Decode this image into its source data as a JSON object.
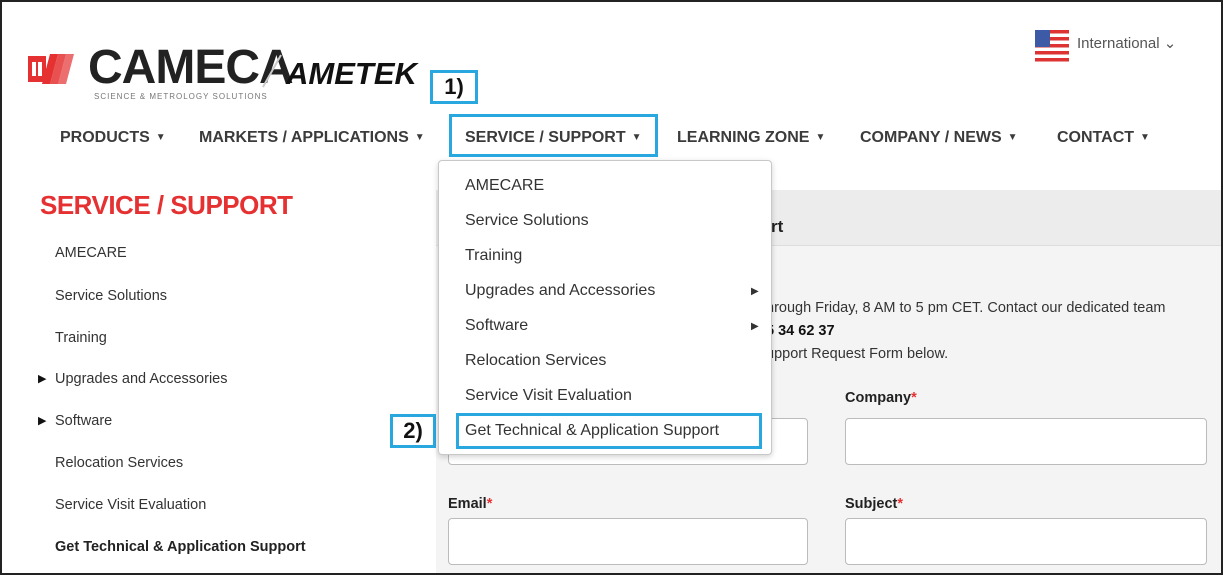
{
  "header": {
    "logo_main": "CAMECA",
    "logo_tagline": "SCIENCE & METROLOGY SOLUTIONS",
    "logo_parent": "AMETEK",
    "locale_label": "International",
    "locale_caret": "⌄"
  },
  "callouts": {
    "step1": "1)",
    "step2": "2)"
  },
  "nav": {
    "items": [
      {
        "label": "PRODUCTS"
      },
      {
        "label": "MARKETS / APPLICATIONS"
      },
      {
        "label": "SERVICE / SUPPORT"
      },
      {
        "label": "LEARNING ZONE"
      },
      {
        "label": "COMPANY / NEWS"
      },
      {
        "label": "CONTACT"
      }
    ],
    "caret": "▼"
  },
  "sidebar": {
    "title": "SERVICE / SUPPORT",
    "items": [
      {
        "label": "AMECARE"
      },
      {
        "label": "Service Solutions"
      },
      {
        "label": "Training"
      },
      {
        "label": "Upgrades and Accessories"
      },
      {
        "label": "Software"
      },
      {
        "label": "Relocation Services"
      },
      {
        "label": "Service Visit Evaluation"
      },
      {
        "label": "Get Technical & Application Support"
      }
    ],
    "expand_glyph": "▶"
  },
  "dropdown": {
    "items": [
      {
        "label": "AMECARE"
      },
      {
        "label": "Service Solutions"
      },
      {
        "label": "Training"
      },
      {
        "label": "Upgrades and Accessories"
      },
      {
        "label": "Software"
      },
      {
        "label": "Relocation Services"
      },
      {
        "label": "Service Visit Evaluation"
      },
      {
        "label": "Get Technical & Application Support"
      }
    ],
    "submenu_glyph": "▶"
  },
  "main": {
    "title_partial": "rt",
    "info_line1": "hrough Friday, 8 AM to 5 pm CET. Contact our dedicated team",
    "info_phone": "5 34 62 37",
    "info_line3": "upport Request Form below.",
    "fields": {
      "company_label": "Company",
      "email_label": "Email",
      "subject_label": "Subject",
      "required_mark": "*"
    }
  },
  "colors": {
    "accent_red": "#e53131",
    "callout_blue": "#29a8e0",
    "panel_bg": "#f4f4f4"
  }
}
